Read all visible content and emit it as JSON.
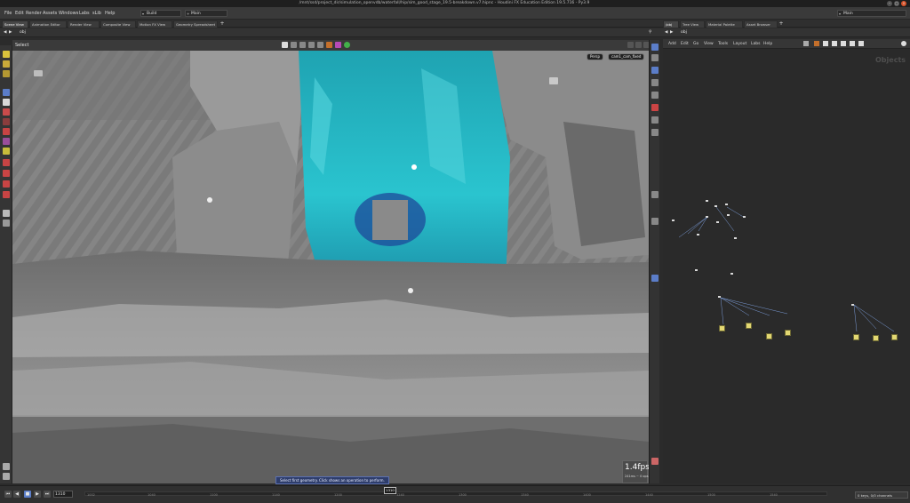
{
  "window": {
    "title": "/mnt/ssd/project_dir/simulation_openvdb/waterfall/hip/sim_good_stage_19.5-breakdown.v7.hipnc - Houdini FX Education Edition 19.5.716 - Py3.9"
  },
  "menubar": {
    "items": [
      "File",
      "Edit",
      "Render",
      "Assets",
      "Windows",
      "Labs",
      "sLib",
      "Help"
    ],
    "desktop_select": "Build",
    "main_select": "Main",
    "right_select": "Main"
  },
  "left_tabs": [
    "Scene View",
    "Animation Editor",
    "Render View",
    "Composite View",
    "Motion FX View",
    "Geometry Spreadsheet"
  ],
  "right_tabs": [
    "/obj",
    "Tree View",
    "Material Palette",
    "Asset Browser"
  ],
  "viewport_path": "obj",
  "network_path": "obj",
  "viewport": {
    "select_label": "Select",
    "persp_label": "Persp",
    "camera_label": "cam1_cam_fixed",
    "fps": "1.4fps",
    "fps_detail": "241ms ~ 0 ops"
  },
  "network_menu": [
    "Add",
    "Edit",
    "Go",
    "View",
    "Tools",
    "Layout",
    "Labs",
    "Help"
  ],
  "network": {
    "context_label": "Objects"
  },
  "status_message": "Select first geometry. Click shows an operation to perform.",
  "timeline": {
    "current_frame": "1310",
    "marker_frame": "1310",
    "ticks": [
      "1002",
      "1040",
      "1100",
      "1140",
      "1200",
      "1240",
      "1300",
      "1340",
      "1400",
      "1440",
      "1500",
      "1540"
    ],
    "render_menu": "0 keys, 0/0 channels"
  },
  "colors": {
    "accent": "#4a78c9",
    "waterfall": "#25c5d0",
    "node": "#e3d873"
  }
}
